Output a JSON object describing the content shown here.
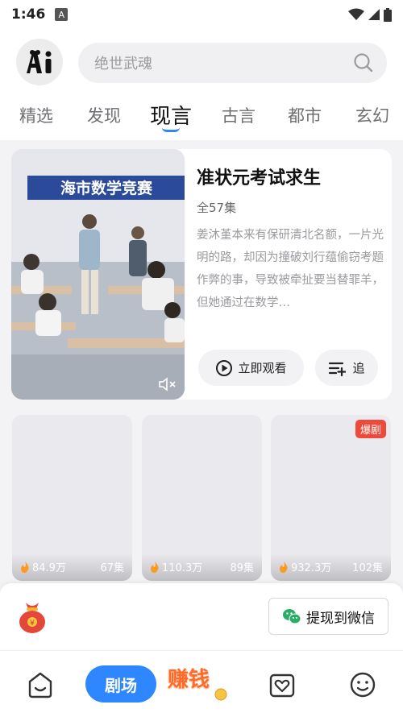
{
  "status_bar": {
    "time": "1:46",
    "notif_icon_letter": "A"
  },
  "header": {
    "logo_text": "Ai",
    "search_placeholder": "绝世武魂"
  },
  "tabs": [
    {
      "label": "精选"
    },
    {
      "label": "发现"
    },
    {
      "label": "现言",
      "active": true
    },
    {
      "label": "古言"
    },
    {
      "label": "都市"
    },
    {
      "label": "玄幻"
    }
  ],
  "feature": {
    "poster_banner": "海市数学竞赛",
    "title": "准状元考试求生",
    "episodes": "全57集",
    "description": "姜沐堇本来有保研清北名额，一片光明的路，却因为撞破刘行蕴偷窃考题作弊的事，导致被牵扯要当替罪羊，但她通过在数学…",
    "watch_label": "立即观看",
    "follow_label": "追"
  },
  "grid": [
    {
      "views": "84.9万",
      "episodes": "67集",
      "badge": ""
    },
    {
      "views": "110.3万",
      "episodes": "89集",
      "badge": ""
    },
    {
      "views": "932.3万",
      "episodes": "102集",
      "badge": "爆剧"
    }
  ],
  "withdraw": {
    "label": "提现到微信"
  },
  "bottom_nav": {
    "theater_label": "剧场",
    "earn_label": "赚钱"
  },
  "colors": {
    "accent": "#2f87ff",
    "hot": "#ee4a3b",
    "wechat": "#2aae67"
  }
}
